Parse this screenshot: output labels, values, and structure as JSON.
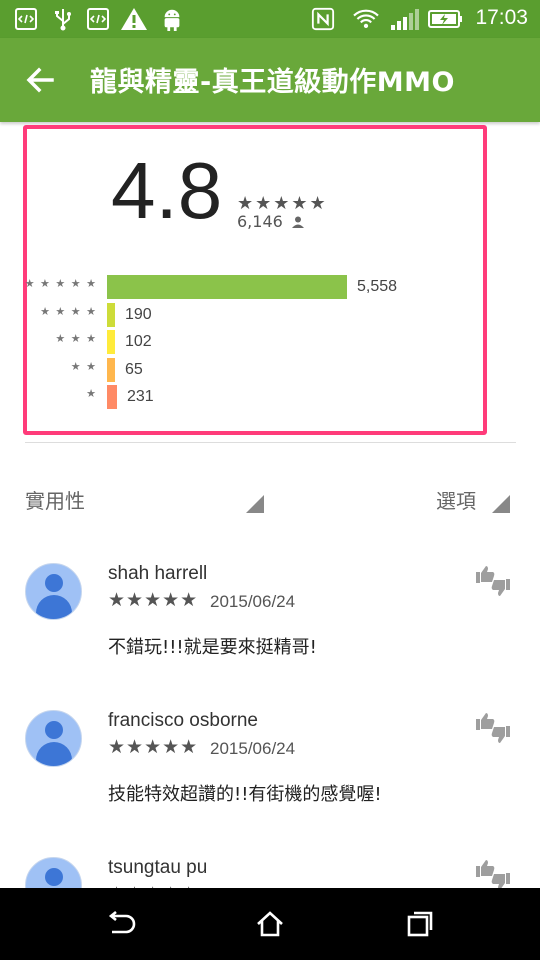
{
  "status_bar": {
    "time": "17:03",
    "icons": [
      "code-icon",
      "usb-icon",
      "code-icon",
      "warning-icon",
      "android-icon",
      "nfc-icon",
      "wifi-icon",
      "signal-icon",
      "battery-charging-icon"
    ]
  },
  "app_bar": {
    "title": "龍與精靈-真王道級動作MMO",
    "back_icon": "arrow-back-icon"
  },
  "rating": {
    "score": "4.8",
    "stars": "★★★★★",
    "total": "6,146",
    "histogram": [
      {
        "stars": "★ ★ ★ ★ ★",
        "count": "5,558",
        "value": 5558,
        "color": "#8bc34a"
      },
      {
        "stars": "★ ★ ★ ★",
        "count": "190",
        "value": 190,
        "color": "#cddc39"
      },
      {
        "stars": "★ ★ ★",
        "count": "102",
        "value": 102,
        "color": "#ffeb3b"
      },
      {
        "stars": "★ ★",
        "count": "65",
        "value": 65,
        "color": "#ffb74d"
      },
      {
        "stars": "★",
        "count": "231",
        "value": 231,
        "color": "#ff8a65"
      }
    ]
  },
  "sort": {
    "label": "實用性",
    "options_label": "選項"
  },
  "reviews": [
    {
      "name": "shah harrell",
      "stars": "★★★★★",
      "date": "2015/06/24",
      "text": "不錯玩!!!就是要來挺精哥!"
    },
    {
      "name": "francisco osborne",
      "stars": "★★★★★",
      "date": "2015/06/24",
      "text": "技能特效超讚的!!有街機的感覺喔!"
    },
    {
      "name": "tsungtau pu",
      "stars": "★★★★★",
      "date": "",
      "text": ""
    }
  ],
  "colors": {
    "status_bar": "#5a9e2f",
    "app_bar": "#69a83a",
    "highlight_border": "#ff3b7a"
  }
}
